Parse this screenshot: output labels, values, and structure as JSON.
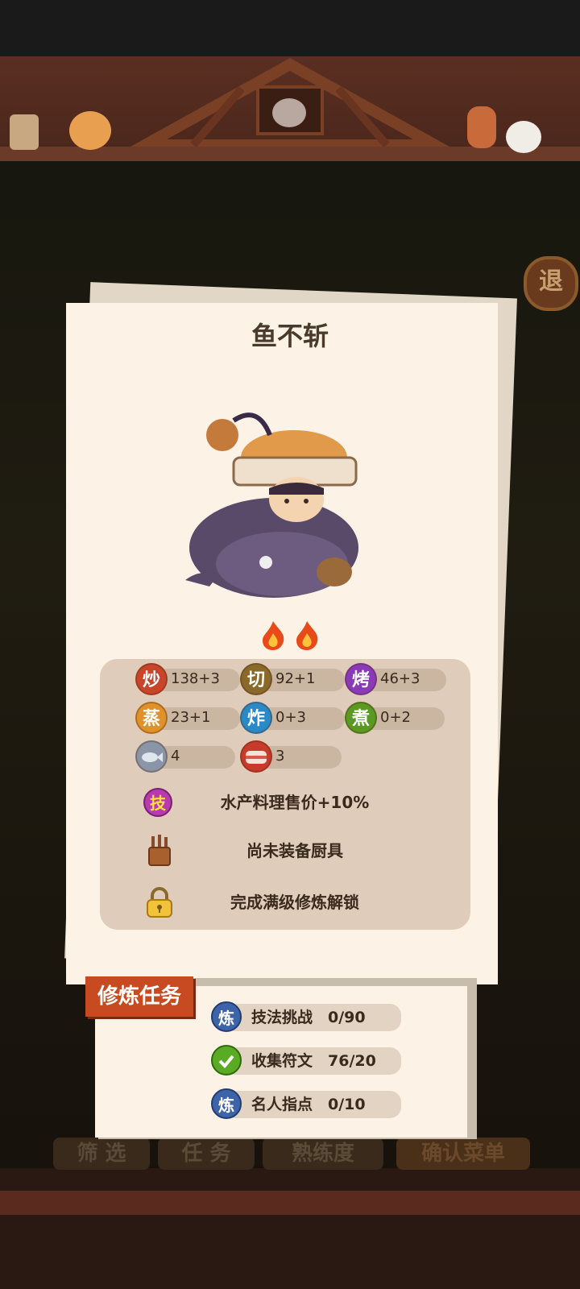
{
  "hero": {
    "name": "鱼不斩",
    "flame_count": 2
  },
  "stats": [
    {
      "icon": "炒",
      "value": "138+3",
      "color": "#c9452a"
    },
    {
      "icon": "切",
      "value": "92+1",
      "color": "#8a6a2a"
    },
    {
      "icon": "烤",
      "value": "46+3",
      "color": "#8a3ab8"
    },
    {
      "icon": "蒸",
      "value": "23+1",
      "color": "#e0922a"
    },
    {
      "icon": "炸",
      "value": "0+3",
      "color": "#2a8ac8"
    },
    {
      "icon": "煮",
      "value": "0+2",
      "color": "#5a9a22"
    },
    {
      "icon": "fish-icon",
      "value": "4",
      "color": "#8a96a8"
    },
    {
      "icon": "meat-icon",
      "value": "3",
      "color": "#c83a2a"
    }
  ],
  "skill": {
    "icon": "技",
    "text": "水产料理售价+10%"
  },
  "equipment": {
    "text": "尚未装备厨具"
  },
  "lock": {
    "text": "完成满级修炼解锁"
  },
  "tasks": {
    "label": "修炼任务",
    "items": [
      {
        "icon": "炼",
        "name": "技法挑战",
        "progress": "0/90",
        "done": false
      },
      {
        "icon": "check-icon",
        "name": "收集符文",
        "progress": "76/20",
        "done": true
      },
      {
        "icon": "炼",
        "name": "名人指点",
        "progress": "0/10",
        "done": false
      }
    ]
  },
  "background": {
    "exit_badge": "退",
    "tabs": [
      "筛 选",
      "任 务",
      "熟练度",
      "确认菜单"
    ]
  }
}
